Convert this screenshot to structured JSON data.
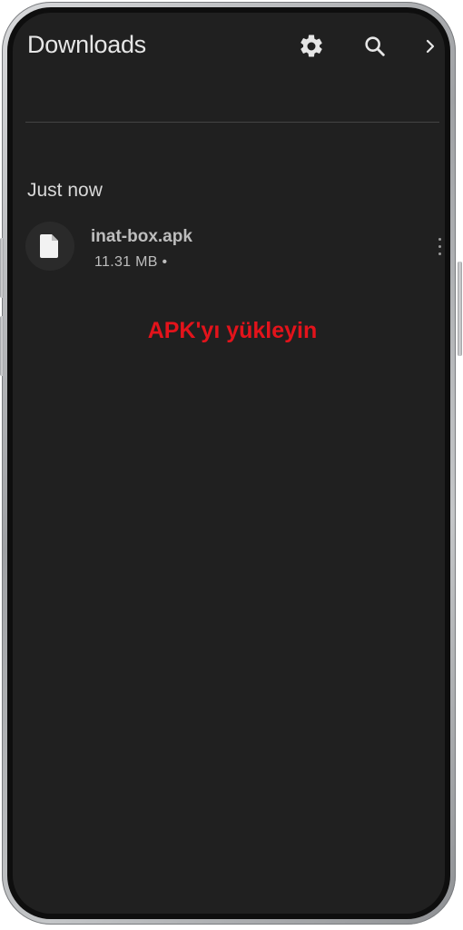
{
  "app_bar": {
    "title": "Downloads",
    "settings_icon": "gear-icon",
    "search_icon": "search-icon",
    "overflow_icon": "chevron-right-icon"
  },
  "section": {
    "header": "Just now"
  },
  "downloads": [
    {
      "icon": "file-icon",
      "name": "inat-box.apk",
      "meta": "11.31 MB •"
    }
  ],
  "annotation": {
    "text": "APK'yı yükleyin",
    "color": "#e3131b"
  },
  "colors": {
    "screen_bg": "#202020",
    "text_primary": "#e6e6e6",
    "text_secondary": "#bdbdbd"
  }
}
